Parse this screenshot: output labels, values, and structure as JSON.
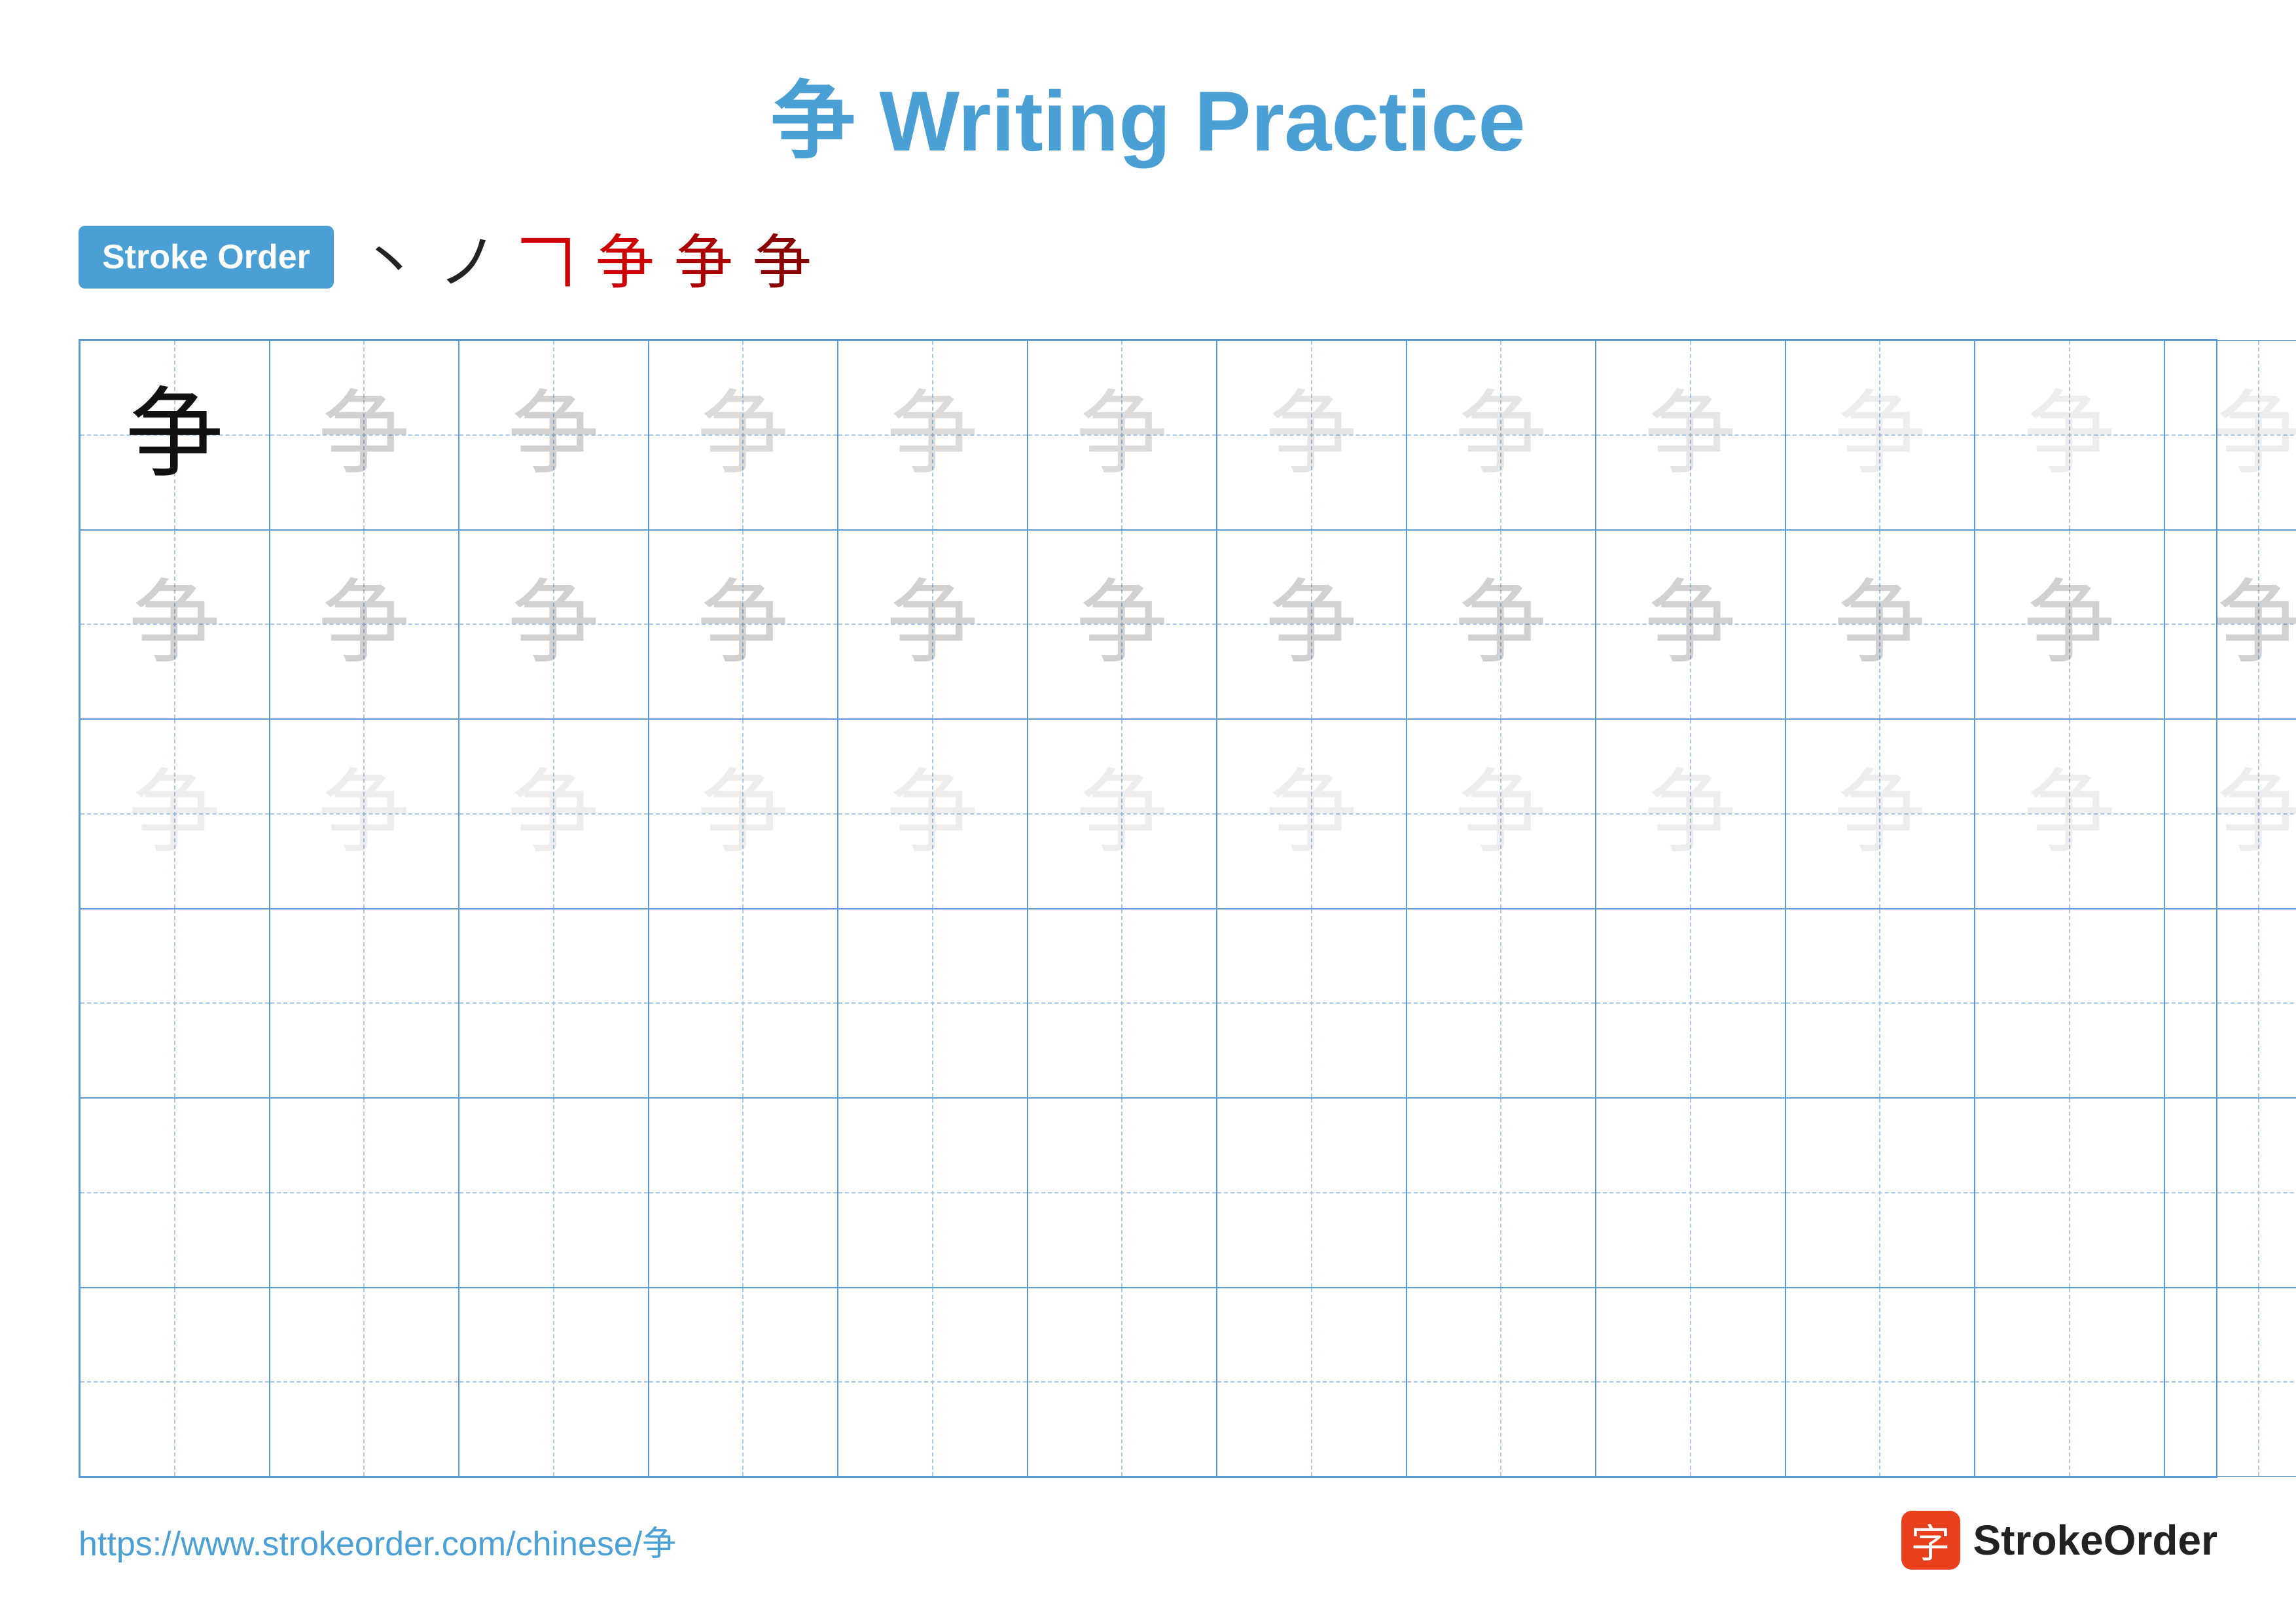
{
  "title": {
    "chinese_char": "争",
    "text": "Writing Practice",
    "full_title": "争 Writing Practice"
  },
  "stroke_order": {
    "badge_label": "Stroke Order",
    "strokes": [
      {
        "char": "㇀",
        "style": "black"
      },
      {
        "char": "㇁",
        "style": "black"
      },
      {
        "char": "争",
        "style": "red",
        "partial": 3
      },
      {
        "char": "争",
        "style": "red",
        "partial": 4
      },
      {
        "char": "争",
        "style": "dark-red",
        "partial": 5
      },
      {
        "char": "争",
        "style": "dark-red",
        "partial": 6
      }
    ]
  },
  "grid": {
    "cols": 13,
    "rows": 6,
    "character": "争",
    "example_row": 0,
    "guide_rows": [
      1,
      2
    ],
    "empty_rows": [
      3,
      4,
      5
    ]
  },
  "footer": {
    "url": "https://www.strokeorder.com/chinese/争",
    "logo_char": "字",
    "logo_text": "StrokeOrder"
  }
}
